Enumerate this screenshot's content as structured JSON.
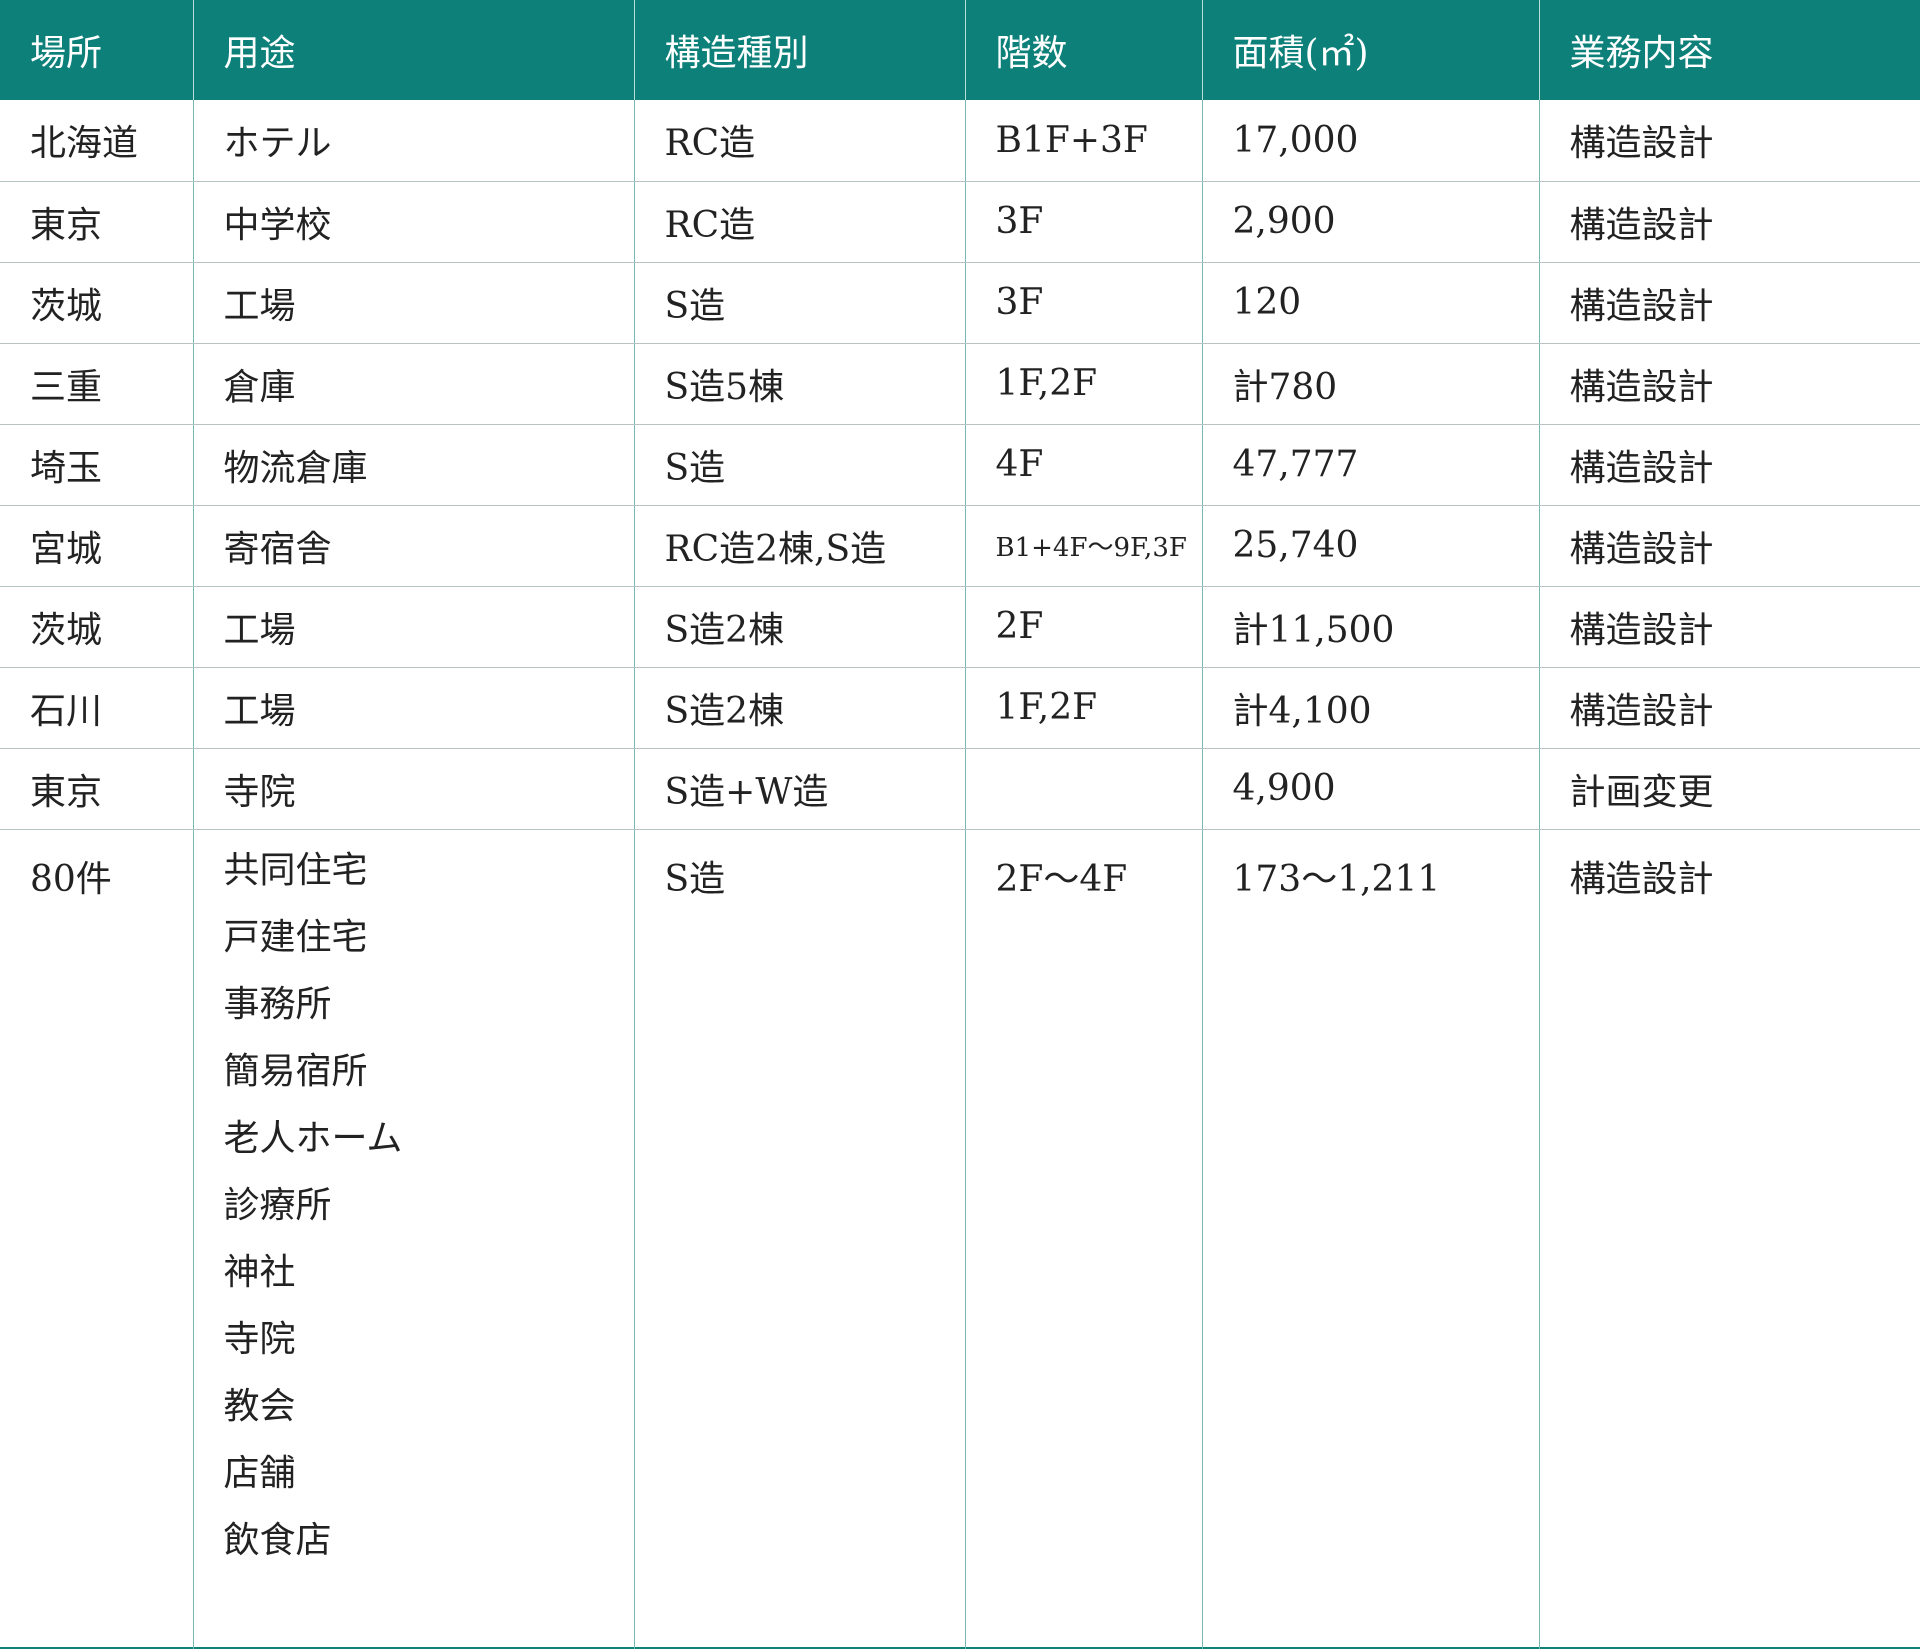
{
  "table": {
    "headers": [
      "場所",
      "用途",
      "構造種別",
      "階数",
      "面積(㎡)",
      "業務内容"
    ],
    "rows": [
      {
        "place": "北海道",
        "use": "ホテル",
        "structure": "RC造",
        "floors": "B1F+3F",
        "area": "17,000",
        "work": "構造設計"
      },
      {
        "place": "東京",
        "use": "中学校",
        "structure": "RC造",
        "floors": "3F",
        "area": "2,900",
        "work": "構造設計"
      },
      {
        "place": "茨城",
        "use": "工場",
        "structure": "S造",
        "floors": "3F",
        "area": "120",
        "work": "構造設計"
      },
      {
        "place": "三重",
        "use": "倉庫",
        "structure": "S造5棟",
        "floors": "1F,2F",
        "area": "計780",
        "work": "構造設計"
      },
      {
        "place": "埼玉",
        "use": "物流倉庫",
        "structure": "S造",
        "floors": "4F",
        "area": "47,777",
        "work": "構造設計"
      },
      {
        "place": "宮城",
        "use": "寄宿舎",
        "structure": "RC造2棟,S造",
        "floors": "B1+4F～9F,3F",
        "area": "25,740",
        "work": "構造設計"
      },
      {
        "place": "茨城",
        "use": "工場",
        "structure": "S造2棟",
        "floors": "2F",
        "area": "計11,500",
        "work": "構造設計"
      },
      {
        "place": "石川",
        "use": "工場",
        "structure": "S造2棟",
        "floors": "1F,2F",
        "area": "計4,100",
        "work": "構造設計"
      },
      {
        "place": "東京",
        "use": "寺院",
        "structure": "S造+W造",
        "floors": "",
        "area": "4,900",
        "work": "計画変更"
      }
    ],
    "last_row": {
      "place": "80件",
      "uses": [
        "共同住宅",
        "戸建住宅",
        "事務所",
        "簡易宿所",
        "老人ホーム",
        "診療所",
        "神社",
        "寺院",
        "教会",
        "店舗",
        "飲食店"
      ],
      "structure": "S造",
      "floors": "2F～4F",
      "area": "173～1,211",
      "work": "構造設計"
    }
  },
  "colors": {
    "header_bg": "#0c8079",
    "header_text": "#ffffff",
    "body_text": "#222222",
    "divider": "#77b8b3"
  }
}
